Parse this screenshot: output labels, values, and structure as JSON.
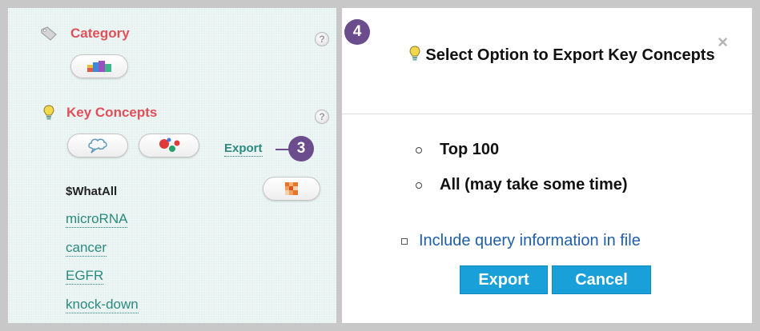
{
  "sidebar": {
    "category": {
      "title": "Category",
      "help": "?"
    },
    "key_concepts": {
      "title": "Key Concepts",
      "help": "?",
      "export_label": "Export",
      "concepts": [
        "$WhatAll",
        "microRNA",
        "cancer",
        "EGFR",
        "knock-down"
      ]
    }
  },
  "callouts": {
    "export_step": "3",
    "dialog_step": "4"
  },
  "dialog": {
    "title": "Select Option to Export Key Concepts",
    "close": "×",
    "options": [
      "Top 100",
      "All (may take some time)"
    ],
    "include_query_label": "Include query information in file",
    "export_button": "Export",
    "cancel_button": "Cancel"
  },
  "colors": {
    "accent_red": "#e0505a",
    "link_teal": "#2a8a7f",
    "callout_purple": "#6b4c8c",
    "button_blue": "#1aa0d8"
  },
  "icons": {
    "category": "tag-icon",
    "key_concepts": "lightbulb-icon",
    "dialog_title": "lightbulb-icon",
    "word_cloud": "cloud-icon",
    "bubble_chart": "bubble-icon",
    "heatmap": "heatmap-icon",
    "category_chart": "color-bars-icon"
  }
}
